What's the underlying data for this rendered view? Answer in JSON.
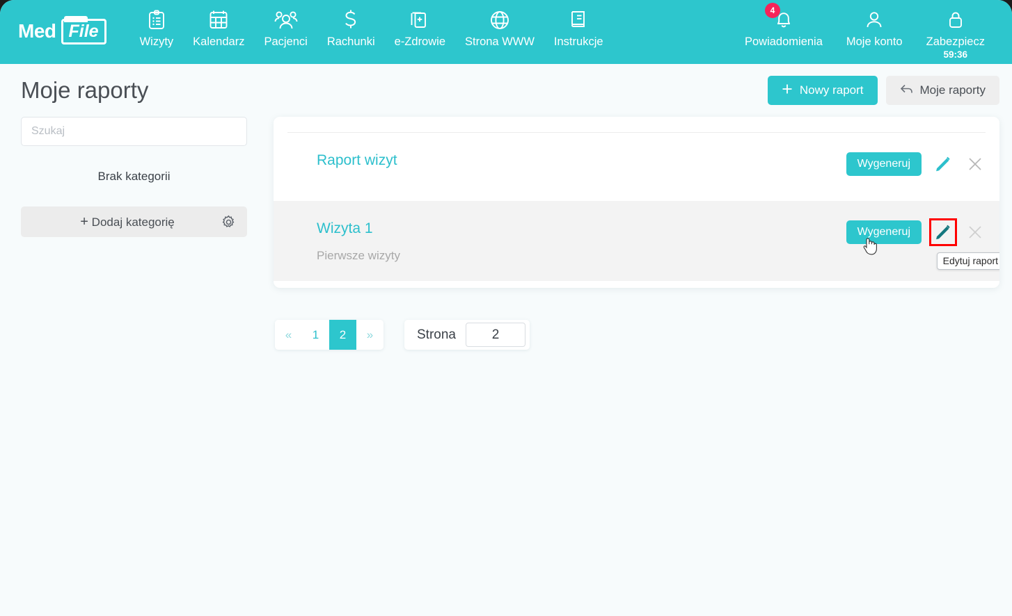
{
  "header": {
    "logo_med": "Med",
    "logo_file": "File",
    "nav": [
      {
        "label": "Wizyty",
        "icon": "clipboard-list-icon"
      },
      {
        "label": "Kalendarz",
        "icon": "calendar-icon"
      },
      {
        "label": "Pacjenci",
        "icon": "people-group-icon"
      },
      {
        "label": "Rachunki",
        "icon": "dollar-icon"
      },
      {
        "label": "e-Zdrowie",
        "icon": "documents-plus-icon"
      },
      {
        "label": "Strona WWW",
        "icon": "globe-icon"
      },
      {
        "label": "Instrukcje",
        "icon": "book-icon"
      }
    ],
    "right_nav": {
      "notifications_label": "Powiadomienia",
      "notifications_count": "4",
      "account_label": "Moje konto",
      "secure_label": "Zabezpiecz",
      "secure_timer": "59:36"
    },
    "bg_color": "#2dc6cd",
    "badge_color": "#f62459"
  },
  "page": {
    "title": "Moje raporty",
    "new_report_button": "Nowy raport",
    "new_report_icon": "plus-icon",
    "my_reports_button": "Moje raporty",
    "my_reports_icon": "back-arrow-icon"
  },
  "sidebar": {
    "search_placeholder": "Szukaj",
    "search_value": "",
    "empty_categories": "Brak kategorii",
    "add_category_label": "Dodaj kategorię",
    "add_category_icon": "plus-icon",
    "settings_icon": "gear-icon"
  },
  "reports": [
    {
      "title": "Raport wizyt",
      "subtitle": "",
      "generate_label": "Wygeneruj",
      "edit_icon": "pencil-icon",
      "delete_icon": "close-x-icon",
      "highlighted": false
    },
    {
      "title": "Wizyta 1",
      "subtitle": "Pierwsze wizyty",
      "generate_label": "Wygeneruj",
      "edit_icon": "pencil-icon",
      "delete_icon": "close-x-icon",
      "highlighted": true
    }
  ],
  "tooltip": {
    "text": "Edytuj raport"
  },
  "pagination": {
    "prev": "«",
    "next": "»",
    "pages": [
      "1",
      "2"
    ],
    "active_page": "2",
    "page_label": "Strona",
    "page_value": "2"
  },
  "colors": {
    "accent": "#2dc6cd",
    "link": "#2cbfcc",
    "page_bg": "#f7fbfc",
    "row_alt_bg": "#f3f3f3",
    "highlight": "#ff0000"
  }
}
